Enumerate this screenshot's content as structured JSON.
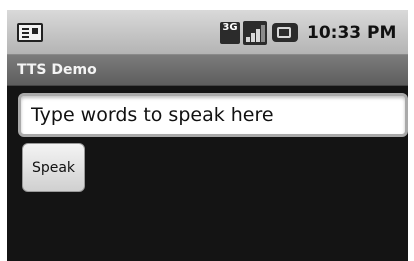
{
  "status_bar": {
    "notification_icon": "notification-icon",
    "network_label": "3G",
    "signal_icon": "signal-bars-icon",
    "battery_icon": "battery-icon",
    "time": "10:33 PM"
  },
  "app": {
    "title": "TTS Demo"
  },
  "main": {
    "input_placeholder": "Type words to speak here",
    "input_value": "",
    "speak_label": "Speak"
  },
  "colors": {
    "status_bar_bg": "#c8c8c8",
    "title_bar_bg": "#6e6e6e",
    "window_bg": "#141414"
  }
}
